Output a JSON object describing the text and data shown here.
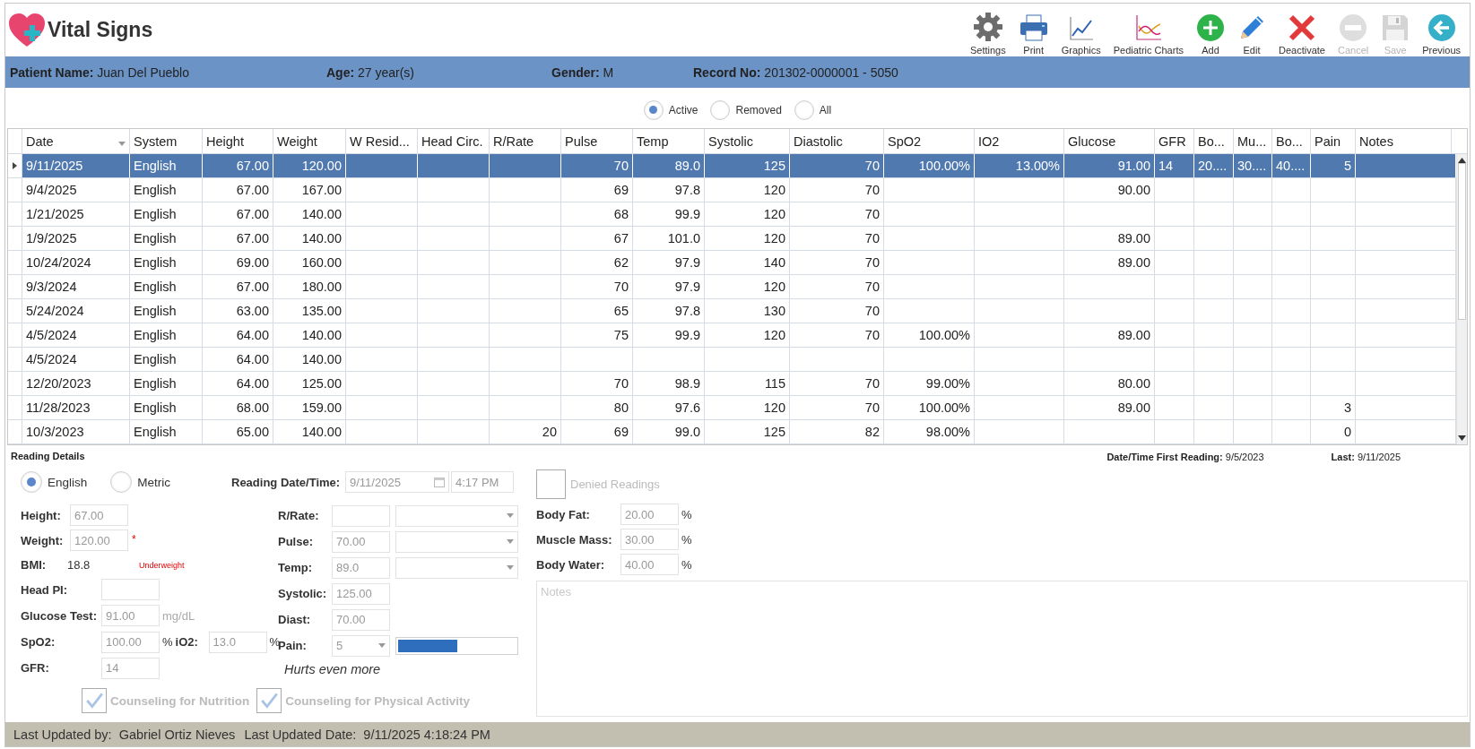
{
  "window": {
    "title": "Vital Signs"
  },
  "toolbar": [
    {
      "label": "Settings",
      "kind": "settings",
      "disabled": false
    },
    {
      "label": "Print",
      "kind": "print",
      "disabled": false
    },
    {
      "label": "Graphics",
      "kind": "graphics",
      "disabled": false
    },
    {
      "label": "Pediatric Charts",
      "kind": "pediatric",
      "disabled": false
    },
    {
      "label": "Add",
      "kind": "add",
      "disabled": false
    },
    {
      "label": "Edit",
      "kind": "edit",
      "disabled": false
    },
    {
      "label": "Deactivate",
      "kind": "deactivate",
      "disabled": false
    },
    {
      "label": "Cancel",
      "kind": "cancel",
      "disabled": true
    },
    {
      "label": "Save",
      "kind": "save",
      "disabled": true
    },
    {
      "label": "Previous",
      "kind": "previous",
      "disabled": false
    }
  ],
  "patient": [
    {
      "label": "Patient Name:",
      "value": "Juan Del Pueblo"
    },
    {
      "label": "Age:",
      "value": "27 year(s)"
    },
    {
      "label": "Gender:",
      "value": "M"
    },
    {
      "label": "Record No:",
      "value": "201302-0000001 - 5050"
    }
  ],
  "filter": [
    {
      "label": "Active",
      "selected": true
    },
    {
      "label": "Removed",
      "selected": false
    },
    {
      "label": "All",
      "selected": false
    }
  ],
  "table": {
    "columns": [
      {
        "label": "Date",
        "kind": "text",
        "sorted": true
      },
      {
        "label": "System",
        "kind": "text",
        "sorted": false
      },
      {
        "label": "Height",
        "kind": "number",
        "sorted": false
      },
      {
        "label": "Weight",
        "kind": "number",
        "sorted": false
      },
      {
        "label": "W Resid...",
        "kind": "number",
        "sorted": false
      },
      {
        "label": "Head Circ.",
        "kind": "number",
        "sorted": false
      },
      {
        "label": "R/Rate",
        "kind": "number",
        "sorted": false
      },
      {
        "label": "Pulse",
        "kind": "number",
        "sorted": false
      },
      {
        "label": "Temp",
        "kind": "number",
        "sorted": false
      },
      {
        "label": "Systolic",
        "kind": "number",
        "sorted": false
      },
      {
        "label": "Diastolic",
        "kind": "number",
        "sorted": false
      },
      {
        "label": "SpO2",
        "kind": "number",
        "sorted": false
      },
      {
        "label": "IO2",
        "kind": "number",
        "sorted": false
      },
      {
        "label": "Glucose",
        "kind": "number",
        "sorted": false
      },
      {
        "label": "GFR",
        "kind": "text",
        "sorted": false
      },
      {
        "label": "Bo...",
        "kind": "text",
        "sorted": false
      },
      {
        "label": "Mu...",
        "kind": "text",
        "sorted": false
      },
      {
        "label": "Bo...",
        "kind": "text",
        "sorted": false
      },
      {
        "label": "Pain",
        "kind": "number",
        "sorted": false
      },
      {
        "label": "Notes",
        "kind": "text",
        "sorted": false
      }
    ],
    "rows": [
      {
        "selected": true,
        "cells": [
          "9/11/2025",
          "English",
          "67.00",
          "120.00",
          null,
          null,
          null,
          "70",
          "89.0",
          "125",
          "70",
          "100.00%",
          "13.00%",
          "91.00",
          "14",
          "20....",
          "30....",
          "40....",
          "5",
          null
        ]
      },
      {
        "selected": false,
        "cells": [
          "9/4/2025",
          "English",
          "67.00",
          "167.00",
          null,
          null,
          null,
          "69",
          "97.8",
          "120",
          "70",
          null,
          null,
          "90.00",
          null,
          null,
          null,
          null,
          null,
          null
        ]
      },
      {
        "selected": false,
        "cells": [
          "1/21/2025",
          "English",
          "67.00",
          "140.00",
          null,
          null,
          null,
          "68",
          "99.9",
          "120",
          "70",
          null,
          null,
          null,
          null,
          null,
          null,
          null,
          null,
          null
        ]
      },
      {
        "selected": false,
        "cells": [
          "1/9/2025",
          "English",
          "67.00",
          "140.00",
          null,
          null,
          null,
          "67",
          "101.0",
          "120",
          "70",
          null,
          null,
          "89.00",
          null,
          null,
          null,
          null,
          null,
          null
        ]
      },
      {
        "selected": false,
        "cells": [
          "10/24/2024",
          "English",
          "69.00",
          "160.00",
          null,
          null,
          null,
          "62",
          "97.9",
          "140",
          "70",
          null,
          null,
          "89.00",
          null,
          null,
          null,
          null,
          null,
          null
        ]
      },
      {
        "selected": false,
        "cells": [
          "9/3/2024",
          "English",
          "67.00",
          "180.00",
          null,
          null,
          null,
          "70",
          "97.9",
          "120",
          "70",
          null,
          null,
          null,
          null,
          null,
          null,
          null,
          null,
          null
        ]
      },
      {
        "selected": false,
        "cells": [
          "5/24/2024",
          "English",
          "63.00",
          "135.00",
          null,
          null,
          null,
          "65",
          "97.8",
          "130",
          "70",
          null,
          null,
          null,
          null,
          null,
          null,
          null,
          null,
          null
        ]
      },
      {
        "selected": false,
        "cells": [
          "4/5/2024",
          "English",
          "64.00",
          "140.00",
          null,
          null,
          null,
          "75",
          "99.9",
          "120",
          "70",
          "100.00%",
          null,
          "89.00",
          null,
          null,
          null,
          null,
          null,
          null
        ]
      },
      {
        "selected": false,
        "cells": [
          "4/5/2024",
          "English",
          "64.00",
          "140.00",
          null,
          null,
          null,
          null,
          null,
          null,
          null,
          null,
          null,
          null,
          null,
          null,
          null,
          null,
          null,
          null
        ]
      },
      {
        "selected": false,
        "cells": [
          "12/20/2023",
          "English",
          "64.00",
          "125.00",
          null,
          null,
          null,
          "70",
          "98.9",
          "115",
          "70",
          "99.00%",
          null,
          "80.00",
          null,
          null,
          null,
          null,
          null,
          null
        ]
      },
      {
        "selected": false,
        "cells": [
          "11/28/2023",
          "English",
          "68.00",
          "159.00",
          null,
          null,
          null,
          "80",
          "97.6",
          "120",
          "70",
          "100.00%",
          null,
          "89.00",
          null,
          null,
          null,
          null,
          "3",
          null
        ]
      },
      {
        "selected": false,
        "cells": [
          "10/3/2023",
          "English",
          "65.00",
          "140.00",
          null,
          null,
          "20",
          "69",
          "99.0",
          "125",
          "82",
          "98.00%",
          null,
          null,
          null,
          null,
          null,
          null,
          "0",
          null
        ]
      }
    ]
  },
  "reading": {
    "title": "Reading Details",
    "first_reading": {
      "label": "Date/Time First Reading:",
      "value": "9/5/2023"
    },
    "last_reading": {
      "label": "Last:",
      "value": "9/11/2025"
    },
    "systems": [
      {
        "label": "English",
        "selected": true
      },
      {
        "label": "Metric",
        "selected": false
      }
    ],
    "reading_datetime": {
      "label": "Reading Date/Time:",
      "date": "9/11/2025",
      "time": "4:17 PM"
    },
    "height": {
      "label": "Height:",
      "value": "67.00"
    },
    "weight": {
      "label": "Weight:",
      "value": "120.00",
      "required_mark": "*"
    },
    "bmi": {
      "label": "BMI:",
      "value": "18.8",
      "status": "Underweight"
    },
    "head_pi": {
      "label": "Head PI:"
    },
    "glucose": {
      "label": "Glucose Test:",
      "value": "91.00",
      "unit": "mg/dL"
    },
    "spo2": {
      "label": "SpO2:",
      "value": "100.00",
      "unit": "%"
    },
    "io2": {
      "label": "iO2:",
      "value": "13.0",
      "unit": "%"
    },
    "gfr": {
      "label": "GFR:",
      "value": "14"
    },
    "vitals": [
      {
        "label": "R/Rate:",
        "kind": "dropdown"
      },
      {
        "label": "Pulse:",
        "value": "70.00",
        "kind": "dropdown"
      },
      {
        "label": "Temp:",
        "value": "89.0",
        "kind": "dropdown"
      },
      {
        "label": "Systolic:",
        "value": "125.00",
        "kind": "plain"
      },
      {
        "label": "Diast:",
        "value": "70.00",
        "kind": "plain"
      }
    ],
    "pain": {
      "label": "Pain:",
      "value": "5",
      "level": 0.5,
      "description": "Hurts even more"
    },
    "counseling": [
      {
        "label": "Counseling for Nutrition",
        "checked": true
      },
      {
        "label": "Counseling for Physical Activity",
        "checked": true
      }
    ],
    "denied_readings": {
      "label": "Denied Readings",
      "checked": false
    },
    "body": [
      {
        "label": "Body Fat:",
        "value": "20.00",
        "unit": "%"
      },
      {
        "label": "Muscle Mass:",
        "value": "30.00",
        "unit": "%"
      },
      {
        "label": "Body Water:",
        "value": "40.00",
        "unit": "%"
      }
    ],
    "notes": {
      "placeholder": "Notes"
    }
  },
  "status_bar": {
    "updated_by_label": "Last Updated by:",
    "updated_by": "Gabriel Ortiz Nieves",
    "updated_date_label": "Last Updated Date:",
    "updated_date": "9/11/2025 4:18:24 PM"
  }
}
